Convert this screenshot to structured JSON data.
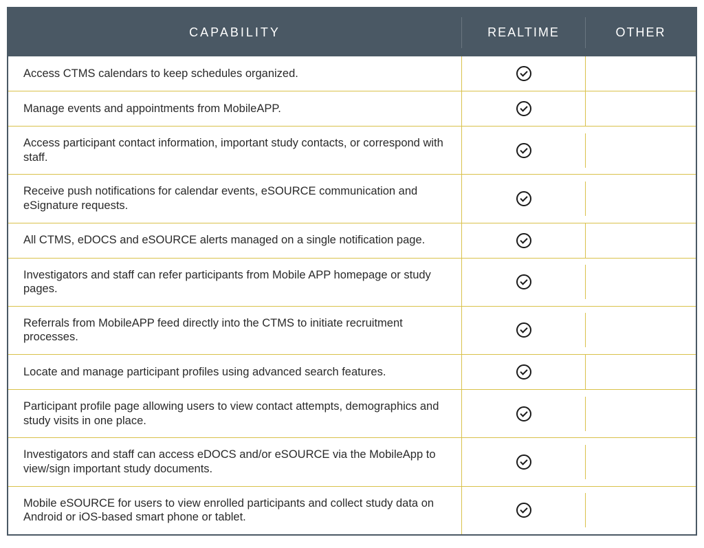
{
  "table": {
    "headers": {
      "capability": "CAPABILITY",
      "realtime": "REALTIME",
      "other": "OTHER"
    },
    "rows": [
      {
        "capability": "Access CTMS calendars to keep schedules organized.",
        "realtime": true,
        "other": false
      },
      {
        "capability": "Manage events and appointments from MobileAPP.",
        "realtime": true,
        "other": false
      },
      {
        "capability": "Access participant contact information, important study contacts, or correspond with staff.",
        "realtime": true,
        "other": false
      },
      {
        "capability": "Receive push notifications for calendar events, eSOURCE communication and eSignature requests.",
        "realtime": true,
        "other": false
      },
      {
        "capability": "All CTMS, eDOCS and eSOURCE alerts managed on a single notification page.",
        "realtime": true,
        "other": false
      },
      {
        "capability": "Investigators and staff can refer participants from Mobile APP homepage or study pages.",
        "realtime": true,
        "other": false
      },
      {
        "capability": "Referrals from MobileAPP feed directly into the CTMS to initiate recruitment processes.",
        "realtime": true,
        "other": false
      },
      {
        "capability": "Locate and manage participant profiles using advanced search features.",
        "realtime": true,
        "other": false
      },
      {
        "capability": "Participant profile page allowing users to view contact attempts, demographics and study visits in one place.",
        "realtime": true,
        "other": false
      },
      {
        "capability": "Investigators and staff can access eDOCS and/or eSOURCE via the MobileApp to view/sign important study documents.",
        "realtime": true,
        "other": false
      },
      {
        "capability": "Mobile eSOURCE for users to view enrolled participants and collect study data on Android or iOS-based smart phone or tablet.",
        "realtime": true,
        "other": false
      }
    ]
  }
}
